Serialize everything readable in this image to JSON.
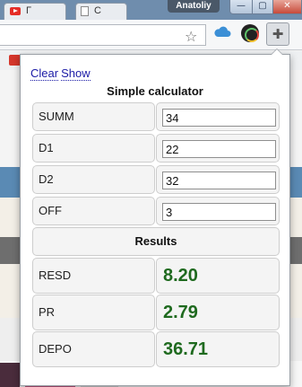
{
  "browser": {
    "tabs": [
      {
        "title": "Г"
      },
      {
        "title": "С"
      }
    ],
    "user_name": "Anatoliy",
    "window_controls": {
      "minimize": "—",
      "maximize": "▢",
      "close": "✕"
    },
    "icons": [
      "youtube-favicon",
      "document-favicon",
      "star-icon",
      "cloud-icon",
      "color-wheel-icon",
      "puzzle-icon"
    ]
  },
  "popup": {
    "links": {
      "clear": "Clear",
      "show": "Show"
    },
    "title": "Simple calculator",
    "inputs": [
      {
        "label": "SUMM",
        "value": "34"
      },
      {
        "label": "D1",
        "value": "22"
      },
      {
        "label": "D2",
        "value": "32"
      },
      {
        "label": "OFF",
        "value": "3"
      }
    ],
    "results_heading": "Results",
    "results": [
      {
        "label": "RESD",
        "value": "8.20"
      },
      {
        "label": "PR",
        "value": "2.79"
      },
      {
        "label": "DEPO",
        "value": "36.71"
      }
    ],
    "result_color": "#1f6a1f"
  }
}
